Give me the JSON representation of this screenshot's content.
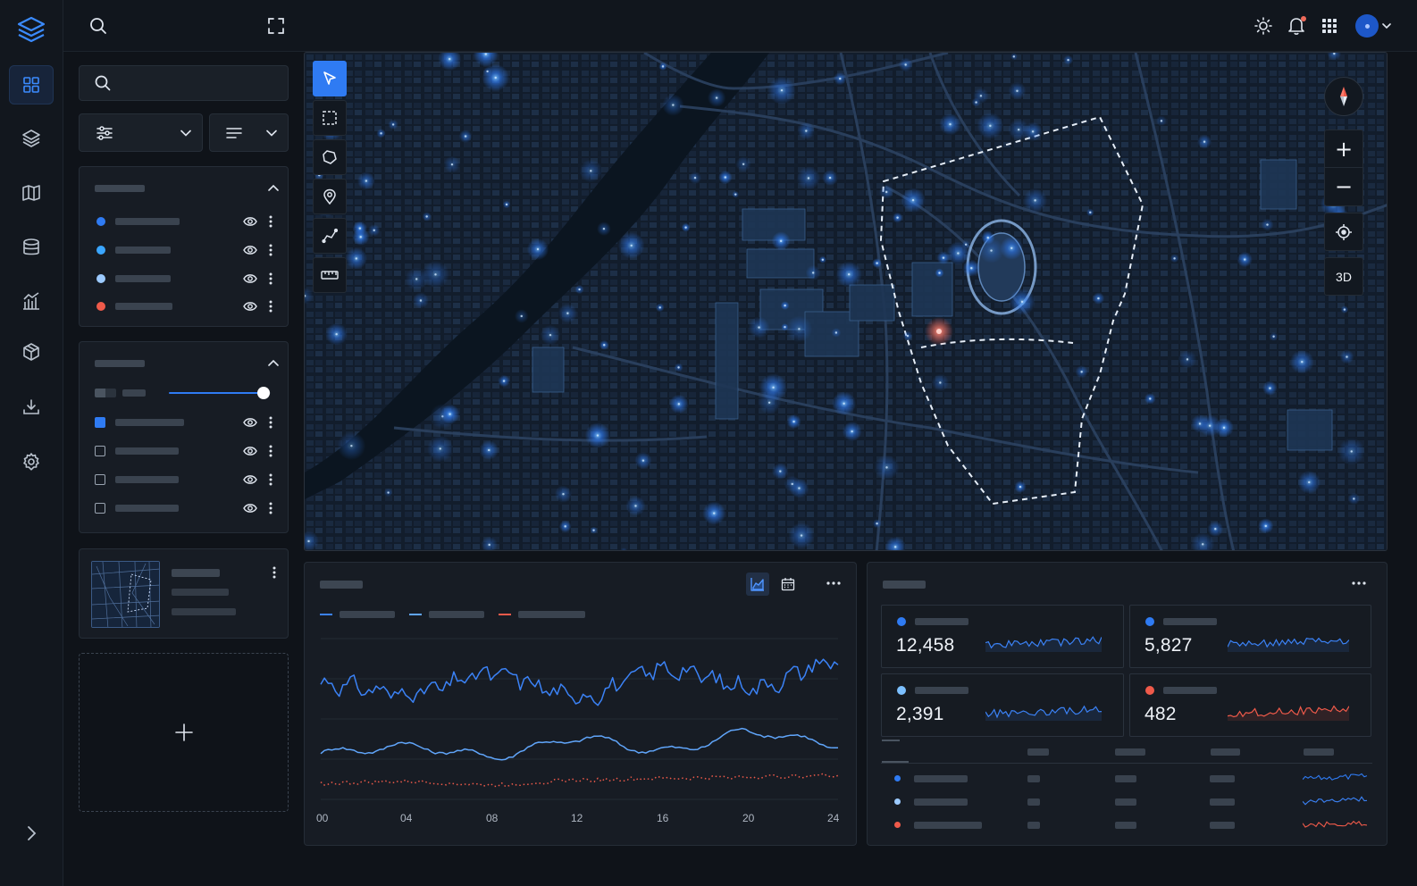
{
  "app": {
    "logo_icon": "layers-logo-icon",
    "accent": "#2f7bf3"
  },
  "nav": [
    {
      "name": "dashboard-icon",
      "active": true
    },
    {
      "name": "layers-icon"
    },
    {
      "name": "map-icon"
    },
    {
      "name": "database-icon"
    },
    {
      "name": "analytics-icon"
    },
    {
      "name": "package-icon"
    },
    {
      "name": "download-icon"
    },
    {
      "name": "settings-icon"
    }
  ],
  "topbar": {
    "icons": [
      "search-icon",
      "fullscreen-icon",
      "brightness-icon",
      "bell-icon",
      "apps-grid-icon",
      "avatar"
    ]
  },
  "sidebar": {
    "search_placeholder": "",
    "layer_colors": [
      "#2f7bf3",
      "#3aa6ff",
      "#9ccaff",
      "#ef5a4a"
    ],
    "second_panel_checked": [
      true,
      false,
      false,
      false
    ],
    "opacity_fraction": 0.93
  },
  "map": {
    "tools": [
      "pointer-tool",
      "rectangle-select-tool",
      "polygon-tool",
      "pin-tool",
      "path-tool",
      "ruler-tool"
    ],
    "zoom_in": "+",
    "zoom_out": "−",
    "view_mode": "3D"
  },
  "chart_data": {
    "type": "line",
    "x": [
      0,
      4,
      8,
      12,
      16,
      20,
      24
    ],
    "x_tick_labels": [
      "00",
      "04",
      "08",
      "12",
      "16",
      "20",
      "24"
    ],
    "series": [
      {
        "color": "#3b82f6",
        "values": [
          0.72,
          0.66,
          0.78,
          0.64,
          0.81,
          0.7,
          0.86
        ]
      },
      {
        "color": "#60a5fa",
        "values": [
          0.29,
          0.33,
          0.27,
          0.38,
          0.3,
          0.42,
          0.34
        ]
      },
      {
        "color": "#ef5a4a",
        "style": "dotted",
        "values": [
          0.1,
          0.11,
          0.09,
          0.12,
          0.13,
          0.14,
          0.15
        ]
      }
    ],
    "grid": true
  },
  "stats": [
    {
      "value": "12,458",
      "color": "#2f7bf3",
      "spark_color": "#3b82f6"
    },
    {
      "value": "5,827",
      "color": "#2f7bf3",
      "spark_color": "#3b82f6"
    },
    {
      "value": "2,391",
      "color": "#7cc0ff",
      "spark_color": "#3b82f6"
    },
    {
      "value": "482",
      "color": "#ef5a4a",
      "spark_color": "#ef5a4a"
    }
  ],
  "table": {
    "dot_colors": [
      "#2f7bf3",
      "#9ccaff",
      "#ef5a4a"
    ]
  }
}
